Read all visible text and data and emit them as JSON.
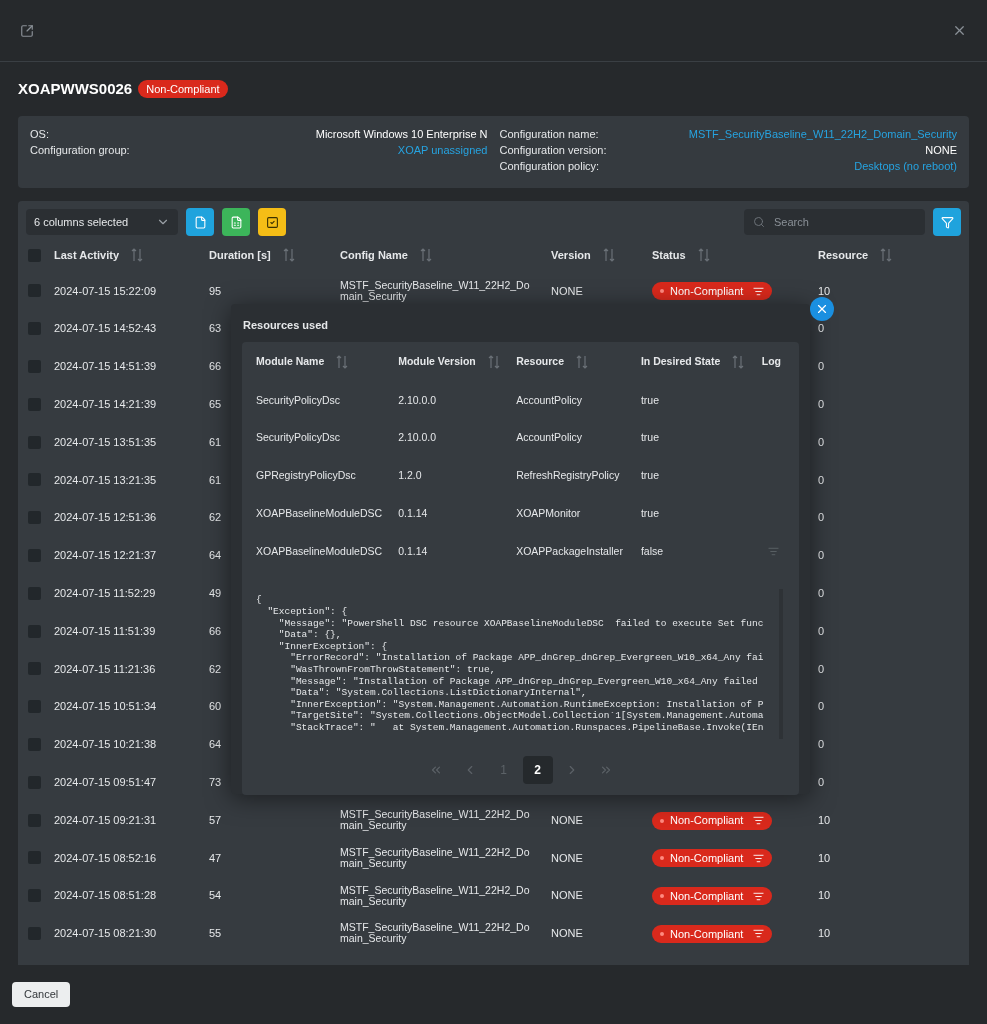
{
  "device": {
    "name": "XOAPWWS0026",
    "status": "Non-Compliant"
  },
  "info": {
    "left": [
      {
        "label": "OS:",
        "value": "Microsoft Windows 10 Enterprise N",
        "kind": "text"
      },
      {
        "label": "Configuration group:",
        "value": "XOAP unassigned",
        "kind": "link"
      }
    ],
    "right": [
      {
        "label": "Configuration name:",
        "value": "MSTF_SecurityBaseline_W11_22H2_Domain_Security",
        "kind": "link"
      },
      {
        "label": "Configuration version:",
        "value": "NONE",
        "kind": "text"
      },
      {
        "label": "Configuration policy:",
        "value": "Desktops (no reboot)",
        "kind": "link"
      }
    ]
  },
  "toolbar": {
    "columns_select": "6 columns selected",
    "search": {
      "placeholder": "Search"
    }
  },
  "table": {
    "header_checked": false,
    "columns": [
      "Last Activity",
      "Duration [s]",
      "Config Name",
      "Version",
      "Status",
      "Resource"
    ],
    "rows": [
      {
        "checked": false,
        "last_activity": "2024-07-15 15:22:09",
        "duration": "95",
        "config_name": "MSTF_SecurityBaseline_W11_22H2_Domain_Security",
        "version": "NONE",
        "status": "Non-Compliant",
        "resource": "10"
      },
      {
        "checked": false,
        "last_activity": "2024-07-15 14:52:43",
        "duration": "63",
        "resource": "0"
      },
      {
        "checked": false,
        "last_activity": "2024-07-15 14:51:39",
        "duration": "66",
        "resource": "0"
      },
      {
        "checked": false,
        "last_activity": "2024-07-15 14:21:39",
        "duration": "65",
        "resource": "0"
      },
      {
        "checked": false,
        "last_activity": "2024-07-15 13:51:35",
        "duration": "61",
        "resource": "0"
      },
      {
        "checked": false,
        "last_activity": "2024-07-15 13:21:35",
        "duration": "61",
        "resource": "0"
      },
      {
        "checked": false,
        "last_activity": "2024-07-15 12:51:36",
        "duration": "62",
        "resource": "0"
      },
      {
        "checked": false,
        "last_activity": "2024-07-15 12:21:37",
        "duration": "64",
        "resource": "0"
      },
      {
        "checked": false,
        "last_activity": "2024-07-15 11:52:29",
        "duration": "49",
        "resource": "0"
      },
      {
        "checked": false,
        "last_activity": "2024-07-15 11:51:39",
        "duration": "66",
        "resource": "0"
      },
      {
        "checked": false,
        "last_activity": "2024-07-15 11:21:36",
        "duration": "62",
        "resource": "0"
      },
      {
        "checked": false,
        "last_activity": "2024-07-15 10:51:34",
        "duration": "60",
        "resource": "0"
      },
      {
        "checked": false,
        "last_activity": "2024-07-15 10:21:38",
        "duration": "64",
        "resource": "0"
      },
      {
        "checked": false,
        "last_activity": "2024-07-15 09:51:47",
        "duration": "73",
        "resource": "0"
      },
      {
        "checked": false,
        "last_activity": "2024-07-15 09:21:31",
        "duration": "57",
        "config_name": "MSTF_SecurityBaseline_W11_22H2_Domain_Security",
        "version": "NONE",
        "status": "Non-Compliant",
        "resource": "10"
      },
      {
        "checked": false,
        "last_activity": "2024-07-15 08:52:16",
        "duration": "47",
        "config_name": "MSTF_SecurityBaseline_W11_22H2_Domain_Security",
        "version": "NONE",
        "status": "Non-Compliant",
        "resource": "10"
      },
      {
        "checked": false,
        "last_activity": "2024-07-15 08:51:28",
        "duration": "54",
        "config_name": "MSTF_SecurityBaseline_W11_22H2_Domain_Security",
        "version": "NONE",
        "status": "Non-Compliant",
        "resource": "10"
      },
      {
        "checked": false,
        "last_activity": "2024-07-15 08:21:30",
        "duration": "55",
        "config_name": "MSTF_SecurityBaseline_W11_22H2_Domain_Security",
        "version": "NONE",
        "status": "Non-Compliant",
        "resource": "10"
      }
    ]
  },
  "popup": {
    "title": "Resources used",
    "columns": [
      "Module Name",
      "Module Version",
      "Resource",
      "In Desired State",
      "Log"
    ],
    "rows": [
      {
        "module": "SecurityPolicyDsc",
        "version": "2.10.0.0",
        "resource": "AccountPolicy",
        "desired": "true",
        "has_log": false
      },
      {
        "module": "SecurityPolicyDsc",
        "version": "2.10.0.0",
        "resource": "AccountPolicy",
        "desired": "true",
        "has_log": false
      },
      {
        "module": "GPRegistryPolicyDsc",
        "version": "1.2.0",
        "resource": "RefreshRegistryPolicy",
        "desired": "true",
        "has_log": false
      },
      {
        "module": "XOAPBaselineModuleDSC",
        "version": "0.1.14",
        "resource": "XOAPMonitor",
        "desired": "true",
        "has_log": false
      },
      {
        "module": "XOAPBaselineModuleDSC",
        "version": "0.1.14",
        "resource": "XOAPPackageInstaller",
        "desired": "false",
        "has_log": true
      }
    ],
    "log": [
      "{",
      "  \"Exception\": {",
      "    \"Message\": \"PowerShell DSC resource XOAPBaselineModuleDSC  failed to execute Set func",
      "    \"Data\": {},",
      "    \"InnerException\": {",
      "      \"ErrorRecord\": \"Installation of Package APP_dnGrep_dnGrep_Evergreen_W10_x64_Any fai",
      "      \"WasThrownFromThrowStatement\": true,",
      "      \"Message\": \"Installation of Package APP_dnGrep_dnGrep_Evergreen_W10_x64_Any failed",
      "      \"Data\": \"System.Collections.ListDictionaryInternal\",",
      "      \"InnerException\": \"System.Management.Automation.RuntimeException: Installation of P",
      "      \"TargetSite\": \"System.Collections.ObjectModel.Collection`1[System.Management.Automa",
      "      \"StackTrace\": \"   at System.Management.Automation.Runspaces.PipelineBase.Invoke(IEn"
    ],
    "pages": [
      {
        "label": "1",
        "selected": false
      },
      {
        "label": "2",
        "selected": true
      }
    ]
  },
  "footer": {
    "cancel": "Cancel"
  }
}
